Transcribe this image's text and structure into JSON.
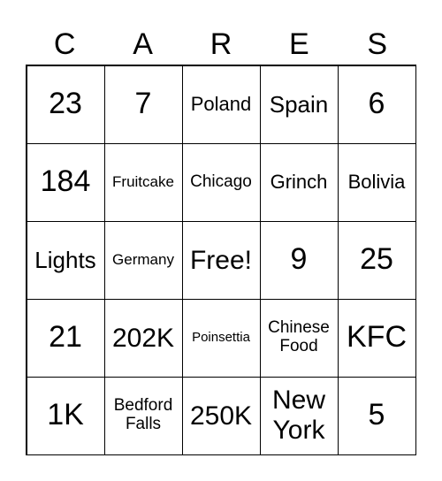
{
  "header": [
    "C",
    "A",
    "R",
    "E",
    "S"
  ],
  "cells": [
    "23",
    "7",
    "Poland",
    "Spain",
    "6",
    "184",
    "Fruitcake",
    "Chicago",
    "Grinch",
    "Bolivia",
    "Lights",
    "Germany",
    "Free!",
    "9",
    "25",
    "21",
    "202K",
    "Poinsettia",
    "Chinese Food",
    "KFC",
    "1K",
    "Bedford Falls",
    "250K",
    "New York",
    "5"
  ]
}
